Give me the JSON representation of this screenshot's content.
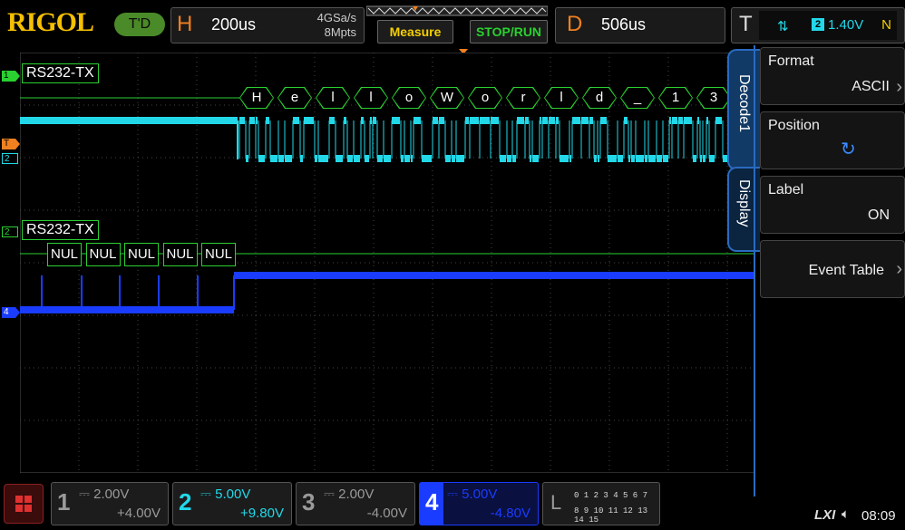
{
  "brand": "RIGOL",
  "trigger_state": "T'D",
  "horizontal": {
    "letter": "H",
    "timebase": "200us",
    "sample_rate": "4GSa/s",
    "memory_depth": "8Mpts"
  },
  "buttons": {
    "measure": "Measure",
    "stop_run": "STOP/RUN"
  },
  "delay": {
    "letter": "D",
    "value": "506us"
  },
  "trigger": {
    "letter": "T",
    "source": "2",
    "level": "1.40V",
    "mode": "N"
  },
  "markers": {
    "ch1": "1",
    "trig": "T",
    "ch2_upper": "2",
    "ch2_lower": "2",
    "ch4": "4",
    "trig_pos": "T"
  },
  "bus1": {
    "label": "RS232-TX",
    "frames": [
      "H",
      "e",
      "l",
      "l",
      "o",
      "W",
      "o",
      "r",
      "l",
      "d",
      "_",
      "1",
      "3"
    ]
  },
  "bus2": {
    "label": "RS232-TX",
    "frames": [
      "NUL",
      "NUL",
      "NUL",
      "NUL",
      "NUL"
    ]
  },
  "menu": {
    "tabs": [
      "Decode1",
      "Display"
    ],
    "items": [
      {
        "label": "Format",
        "value": "ASCII"
      },
      {
        "label": "Position",
        "value": "↻"
      },
      {
        "label": "Label",
        "value": "ON"
      },
      {
        "label": "Event Table",
        "value": ""
      }
    ]
  },
  "channels": [
    {
      "num": "1",
      "scale": "2.00V",
      "offset": "+4.00V",
      "color": "#9a9a9a"
    },
    {
      "num": "2",
      "scale": "5.00V",
      "offset": "+9.80V",
      "color": "#22d8e8"
    },
    {
      "num": "3",
      "scale": "2.00V",
      "offset": "-4.00V",
      "color": "#9a9a9a"
    },
    {
      "num": "4",
      "scale": "5.00V",
      "offset": "-4.80V",
      "color": "#1a3cff"
    }
  ],
  "logic": {
    "letter": "L",
    "row1": "0 1 2 3  4 5 6 7",
    "row2": "8 9 10 11 12 13 14 15"
  },
  "status": {
    "lxi": "LXI",
    "time": "08:09"
  },
  "colors": {
    "cyan": "#22d8e8",
    "blue": "#1a3cff",
    "green": "#2ad030",
    "orange": "#f08020",
    "yellow": "#f5d000"
  }
}
